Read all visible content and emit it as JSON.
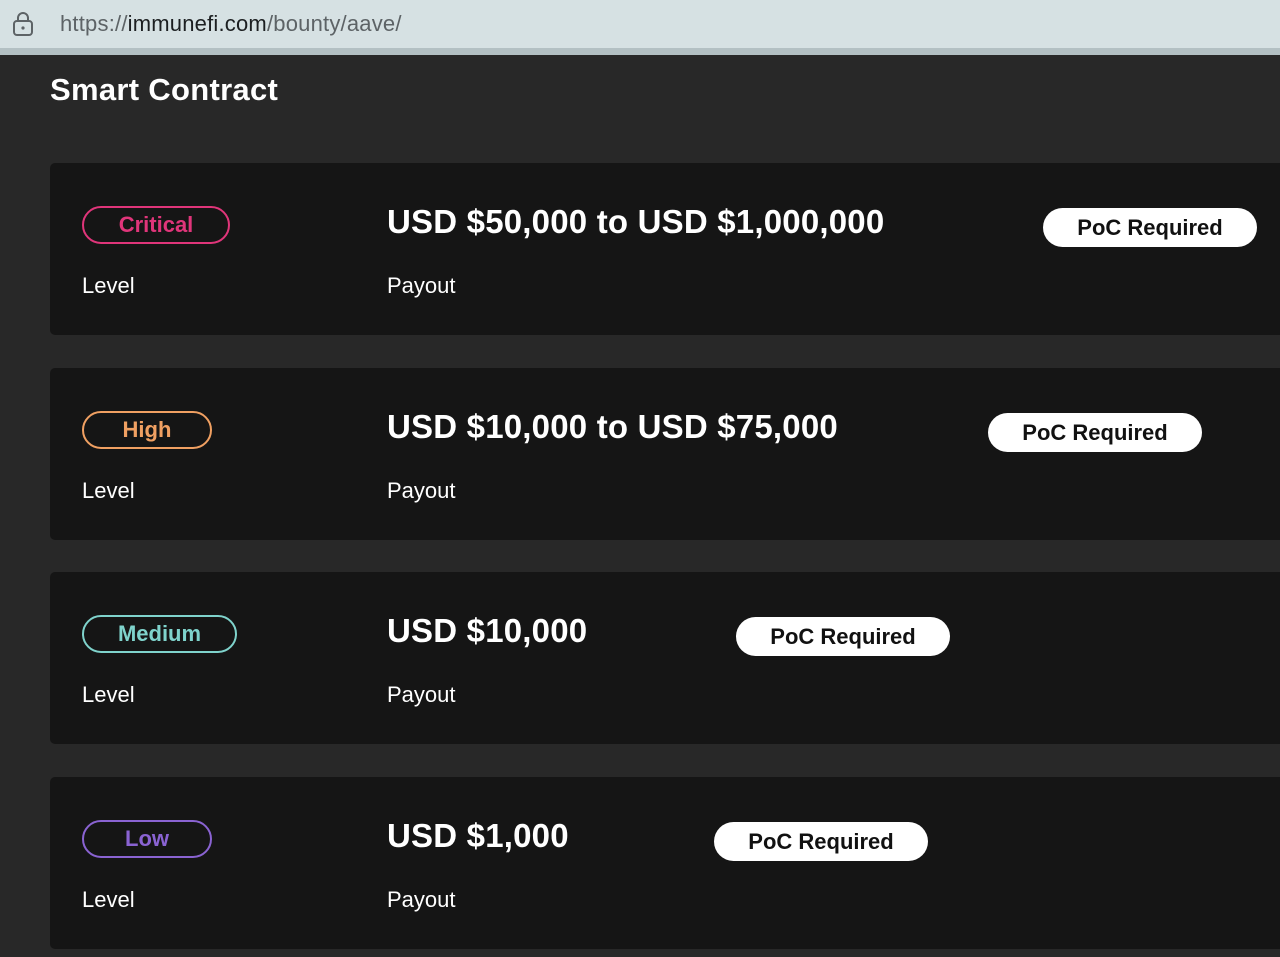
{
  "browser": {
    "url_prefix": "https://",
    "url_host": "immunefi.com",
    "url_path": "/bounty/aave/"
  },
  "section": {
    "title": "Smart Contract"
  },
  "rows": [
    {
      "level": "Critical",
      "level_color": "#e0357a",
      "level_caption": "Level",
      "payout": "USD $50,000 to USD $1,000,000",
      "payout_caption": "Payout",
      "badge": "PoC Required"
    },
    {
      "level": "High",
      "level_color": "#f0a062",
      "level_caption": "Level",
      "payout": "USD $10,000 to USD $75,000",
      "payout_caption": "Payout",
      "badge": "PoC Required"
    },
    {
      "level": "Medium",
      "level_color": "#7fd3cc",
      "level_caption": "Level",
      "payout": "USD $10,000",
      "payout_caption": "Payout",
      "badge": "PoC Required"
    },
    {
      "level": "Low",
      "level_color": "#8a63d2",
      "level_caption": "Level",
      "payout": "USD $1,000",
      "payout_caption": "Payout",
      "badge": "PoC Required"
    }
  ]
}
